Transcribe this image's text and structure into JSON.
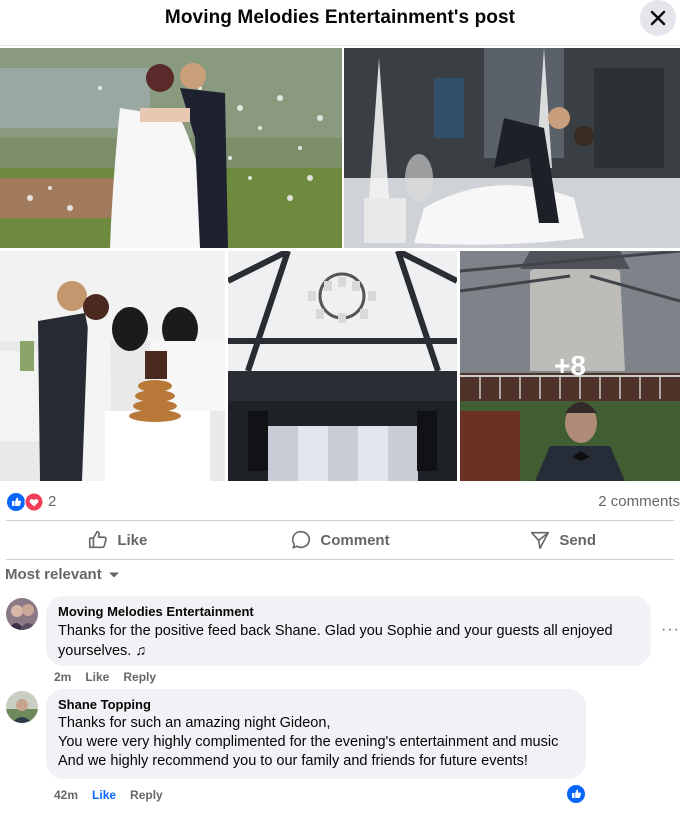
{
  "header": {
    "title": "Moving Melodies Entertainment's post"
  },
  "photos": {
    "more_count": "+8"
  },
  "reactions": {
    "count": "2",
    "comments": "2 comments"
  },
  "actions": {
    "like": "Like",
    "comment": "Comment",
    "send": "Send"
  },
  "sort": {
    "label": "Most relevant"
  },
  "comments": [
    {
      "author": "Moving Melodies Entertainment",
      "text": "Thanks for the positive feed back Shane. Glad you Sophie and your guests all enjoyed yourselves. ♫",
      "time": "2m",
      "like": "Like",
      "reply": "Reply"
    },
    {
      "author": "Shane Topping",
      "lines": [
        "Thanks for such an amazing night Gideon,",
        "You were very highly complimented for the evening's entertainment and music",
        "And we highly recommend you to our family and friends for future events!"
      ],
      "time": "42m",
      "like": "Like",
      "reply": "Reply"
    }
  ],
  "colors": {
    "accent": "#0866ff",
    "love": "#f33e58",
    "secondary_text": "#65676b",
    "bubble": "#f0f2f5"
  },
  "icons": [
    "close-icon",
    "like-reaction-icon",
    "love-reaction-icon",
    "thumbs-up-icon",
    "comment-icon",
    "send-icon",
    "chevron-down-icon",
    "more-options-icon"
  ]
}
